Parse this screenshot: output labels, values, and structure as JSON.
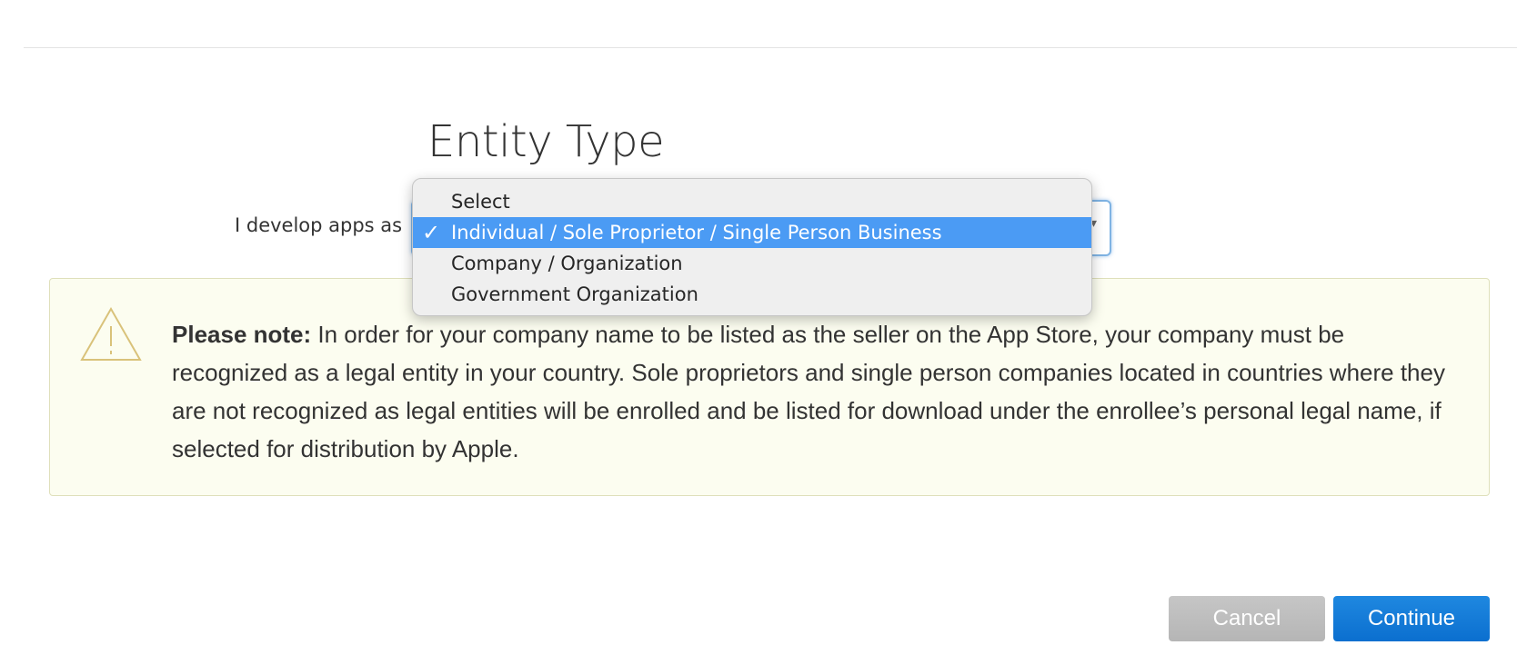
{
  "header": {
    "title": "Entity Type"
  },
  "form": {
    "label": "I develop apps as",
    "selected_value": "Individual / Sole Proprietor / Single Person Business",
    "options": [
      "Select",
      "Individual / Sole Proprietor / Single Person Business",
      "Company / Organization",
      "Government Organization"
    ],
    "selected_index": 1
  },
  "note": {
    "icon": "warning-triangle-icon",
    "label": "Please note:",
    "text": " In order for your company name to be listed as the seller on the App Store, your company must be recognized as a legal entity in your country. Sole proprietors and single person companies located in countries where they are not recognized as legal entities will be enrolled and be listed for download under the enrollee’s personal legal name, if selected for distribution by Apple."
  },
  "buttons": {
    "cancel_label": "Cancel",
    "continue_label": "Continue"
  },
  "colors": {
    "highlight": "#4b9bf4",
    "primary_button": "#1a7fdb",
    "secondary_button": "#bdbdbd",
    "note_background": "#fcfdf0"
  }
}
